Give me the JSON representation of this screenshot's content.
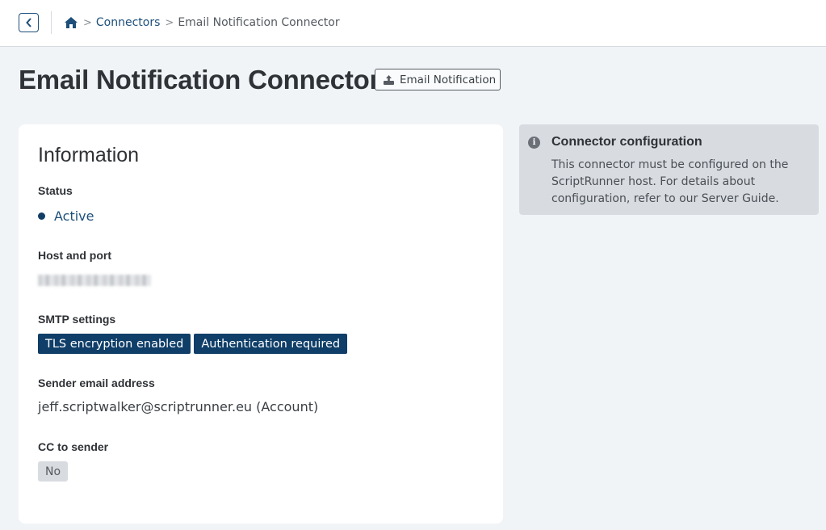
{
  "breadcrumb": {
    "home_icon": "home-icon",
    "items": [
      "Connectors",
      "Email Notification Connector"
    ],
    "separator": ">"
  },
  "page": {
    "title": "Email Notification Connector",
    "type_badge": "Email Notification"
  },
  "information": {
    "heading": "Information",
    "status_label": "Status",
    "status_value": "Active",
    "host_label": "Host and port",
    "smtp_label": "SMTP settings",
    "smtp_tags": [
      "TLS encryption enabled",
      "Authentication required"
    ],
    "sender_label": "Sender email address",
    "sender_value": "jeff.scriptwalker@scriptrunner.eu (Account)",
    "cc_label": "CC to sender",
    "cc_value": "No"
  },
  "config_panel": {
    "title": "Connector configuration",
    "body": "This connector must be configured on the ScriptRunner host. For details about configuration, refer to our Server Guide."
  },
  "colors": {
    "accent": "#1d4f7a",
    "tag_bg": "#0f3e68",
    "page_bg": "#f1f4f7",
    "panel_bg": "#d8dce1"
  }
}
